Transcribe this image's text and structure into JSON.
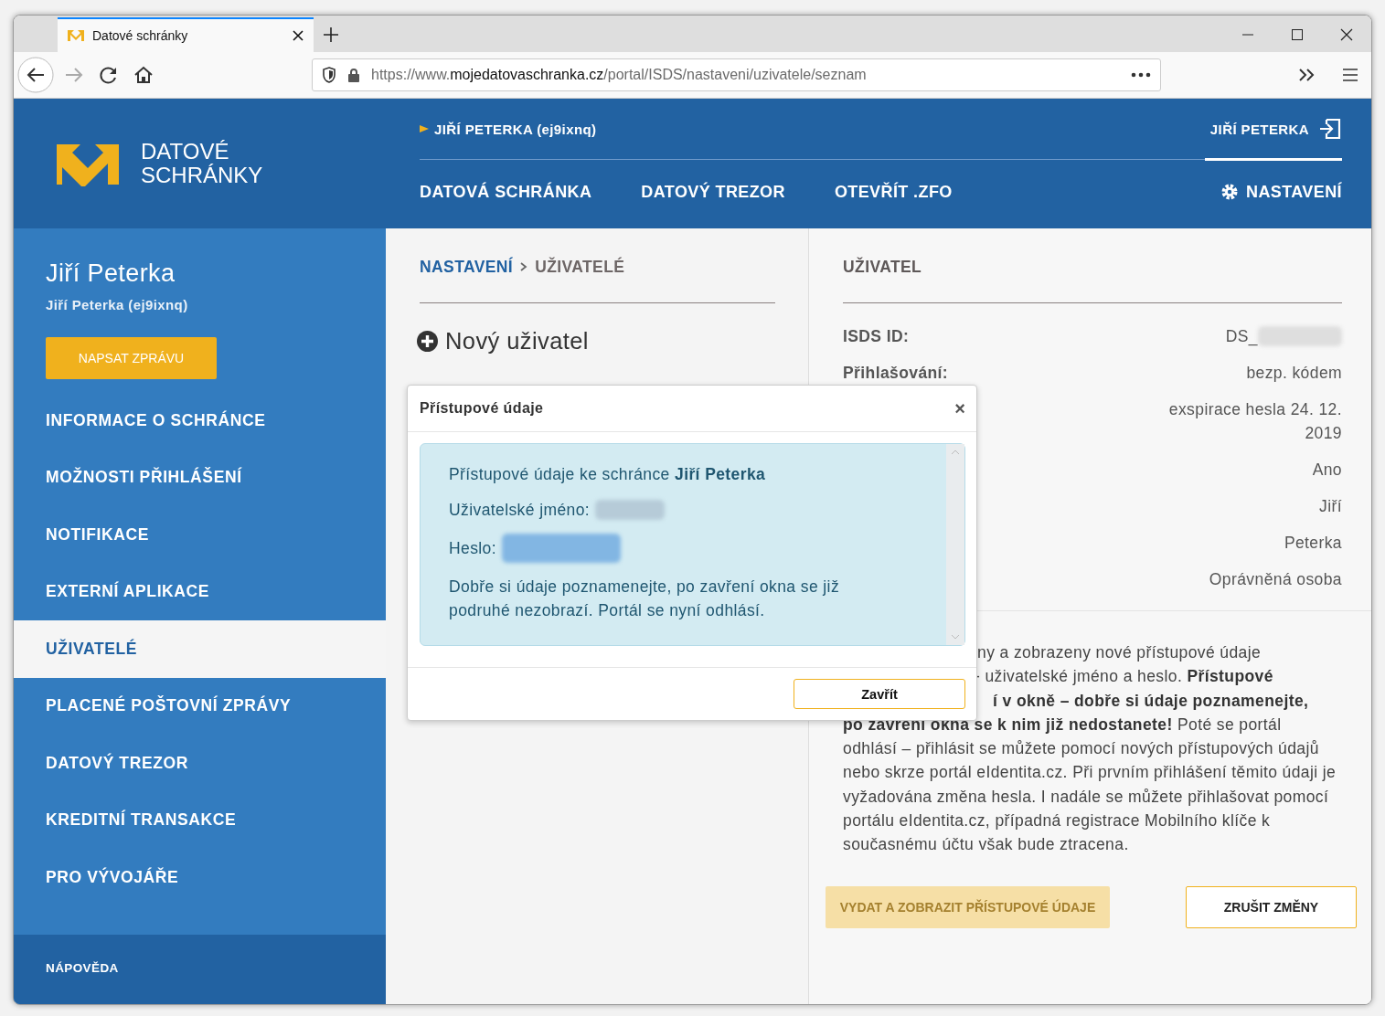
{
  "browser": {
    "tab_title": "Datové schránky",
    "url_prefix": "https://www.",
    "url_domain": "mojedatovaschranka.cz",
    "url_path": "/portal/ISDS/nastaveni/uzivatele/seznam"
  },
  "header": {
    "logo_line1": "DATOVÉ",
    "logo_line2": "SCHRÁNKY",
    "account": "JIŘÍ PETERKA (ej9ixnq)",
    "user": "JIŘÍ PETERKA",
    "nav": [
      {
        "label": "DATOVÁ SCHRÁNKA",
        "selected": false
      },
      {
        "label": "DATOVÝ TREZOR",
        "selected": false
      },
      {
        "label": "OTEVŘÍT .ZFO",
        "selected": false
      },
      {
        "label": "NASTAVENÍ",
        "selected": true
      }
    ]
  },
  "sidebar": {
    "name": "Jiří Peterka",
    "account": "Jiří Peterka (ej9ixnq)",
    "compose_button": "NAPSAT ZPRÁVU",
    "items": [
      {
        "label": "INFORMACE O SCHRÁNCE",
        "selected": false
      },
      {
        "label": "MOŽNOSTI PŘIHLÁŠENÍ",
        "selected": false
      },
      {
        "label": "NOTIFIKACE",
        "selected": false
      },
      {
        "label": "EXTERNÍ APLIKACE",
        "selected": false
      },
      {
        "label": "UŽIVATELÉ",
        "selected": true
      },
      {
        "label": "PLACENÉ POŠTOVNÍ ZPRÁVY",
        "selected": false
      },
      {
        "label": "DATOVÝ TREZOR",
        "selected": false
      },
      {
        "label": "KREDITNÍ TRANSAKCE",
        "selected": false
      },
      {
        "label": "PRO VÝVOJÁŘE",
        "selected": false
      }
    ],
    "footer_title": "NÁPOVĚDA"
  },
  "main": {
    "breadcrumb": [
      "NASTAVENÍ",
      "UŽIVATELÉ"
    ],
    "new_user": "Nový uživatel"
  },
  "detail": {
    "title": "UŽIVATEL",
    "fields": [
      {
        "label": "ISDS ID:",
        "value": "DS_"
      },
      {
        "label": "Přihlašování:",
        "value": "bezp. kódem"
      },
      {
        "value": "exspirace hesla 24. 12. 2019"
      },
      {
        "value": "Ano"
      },
      {
        "value": "Jiří"
      },
      {
        "value": "Peterka"
      },
      {
        "value": "Oprávněná osoba"
      }
    ],
    "note_fragments": [
      "ny a zobrazeny nové přístupové údaje",
      "- uživatelské jméno a heslo. **Přístupové**",
      "**í v okně – dobře si údaje poznamenejte,**"
    ],
    "note": "**po zavření okna se k nim již nedostanete!** Poté se portál odhlásí – přihlásit se můžete pomocí nových přístupových údajů nebo skrze portál eIdentita.cz. Při prvním přihlášení těmito údaji je vyžadována změna hesla. I nadále se můžete přihlašovat pomocí portálu eIdentita.cz, případná registrace Mobilního klíče k současnému účtu však bude ztracena.",
    "buttons": [
      {
        "label": "VYDAT A ZOBRAZIT PŘÍSTUPOVÉ ÚDAJE",
        "kind": "primary",
        "disabled": true
      },
      {
        "label": "ZRUŠIT ZMĚNY",
        "kind": "secondary",
        "disabled": false
      }
    ]
  },
  "dialog": {
    "title": "Přístupové údaje",
    "close": "×",
    "intro": "Přístupové údaje ke schránce **Jiří Peterka**",
    "username_label": "Uživatelské jméno:",
    "password_label": "Heslo:",
    "note": "Dobře si údaje poznamenejte, po zavření okna se již podruhé nezobrazí. Portál se nyní odhlásí.",
    "button": "Zavřít"
  }
}
